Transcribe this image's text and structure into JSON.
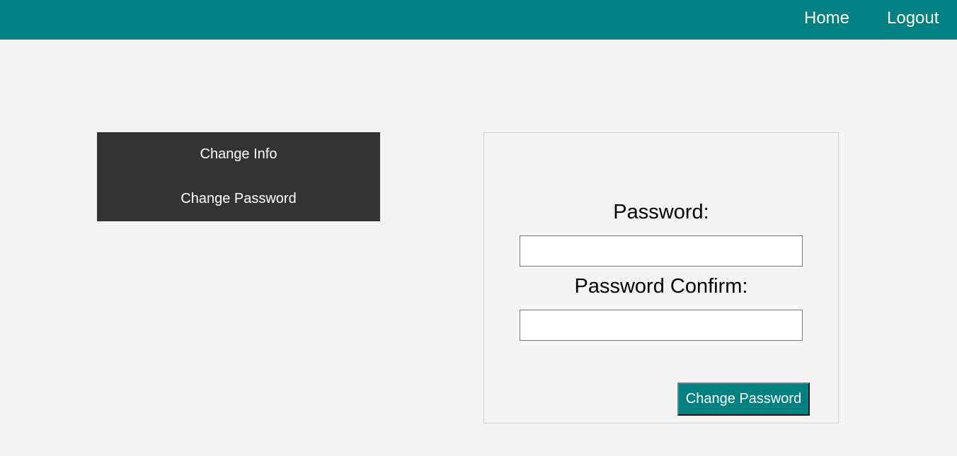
{
  "header": {
    "nav": {
      "home_label": "Home",
      "logout_label": "Logout"
    }
  },
  "sidebar": {
    "items": [
      {
        "label": "Change Info"
      },
      {
        "label": "Change Password"
      }
    ]
  },
  "form": {
    "password_label": "Password:",
    "password_value": "",
    "confirm_label": "Password Confirm:",
    "confirm_value": "",
    "submit_label": "Change Password"
  },
  "colors": {
    "brand": "#008080",
    "sidebar_bg": "#333333",
    "page_bg": "#f4f4f4"
  }
}
